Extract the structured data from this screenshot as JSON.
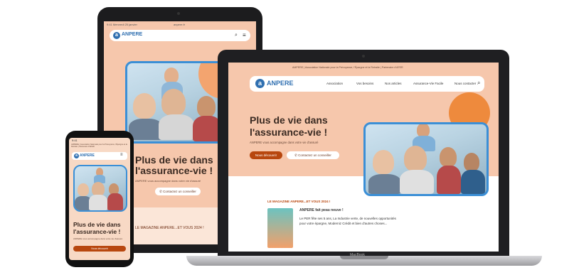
{
  "brand": {
    "name": "ANPERE",
    "mark": "a"
  },
  "laptop": {
    "topbar": "AMPERE | Association Nationale pour la Prévoyance, l'Épargne et la Retraite | Partenaire d'AFER",
    "nav": [
      "Association",
      "Vos besoins",
      "Nos articles",
      "Assurance-Vie Facile",
      "Nous contacter"
    ],
    "hero_title_1": "Plus de vie dans",
    "hero_title_2": "l'assurance-vie !",
    "hero_sub": "ANPERE vous accompagne dans votre vie d'assuré",
    "btn_primary": "Nous découvrir",
    "btn_secondary": "Contactez un conseiller",
    "magazine_heading": "LE MAGAZINE ANPERE...ET VOUS 2024 !",
    "magazine_title": "ANPERE fait peau neuve !",
    "magazine_text": "Le PER fête ses 5 ans, La Industrie verte, de nouvelles opportunités pour votre épargne, Moderniz Crédit et bien d'autres choses...",
    "model": "MacBook"
  },
  "tablet": {
    "status_left": "9:41 Mercredi 25 janvier",
    "url": "anpere.fr",
    "hero_title_1": "Plus de vie dans",
    "hero_title_2": "l'assurance-vie !",
    "hero_sub": "ANPERE vous accompagne dans votre vie d'assuré",
    "btn_secondary": "Contactez un conseiller",
    "magazine_heading": "LE MAGAZINE ANPERE...ET VOUS 2024 !"
  },
  "phone": {
    "status_time": "9:41",
    "topbar": "AMPERE | Association Nationale pour la Prévoyance, l'Épargne et la Retraite | Partenaire d'AFER",
    "hero_title_1": "Plus de vie dans",
    "hero_title_2": "l'assurance-vie !",
    "hero_sub": "ANPERE vous accompagne dans votre vie d'assuré",
    "btn_primary": "Nous découvrir"
  },
  "colors": {
    "accent": "#b8470f",
    "peach": "#f6c7ac",
    "blue": "#3b8fd6"
  }
}
